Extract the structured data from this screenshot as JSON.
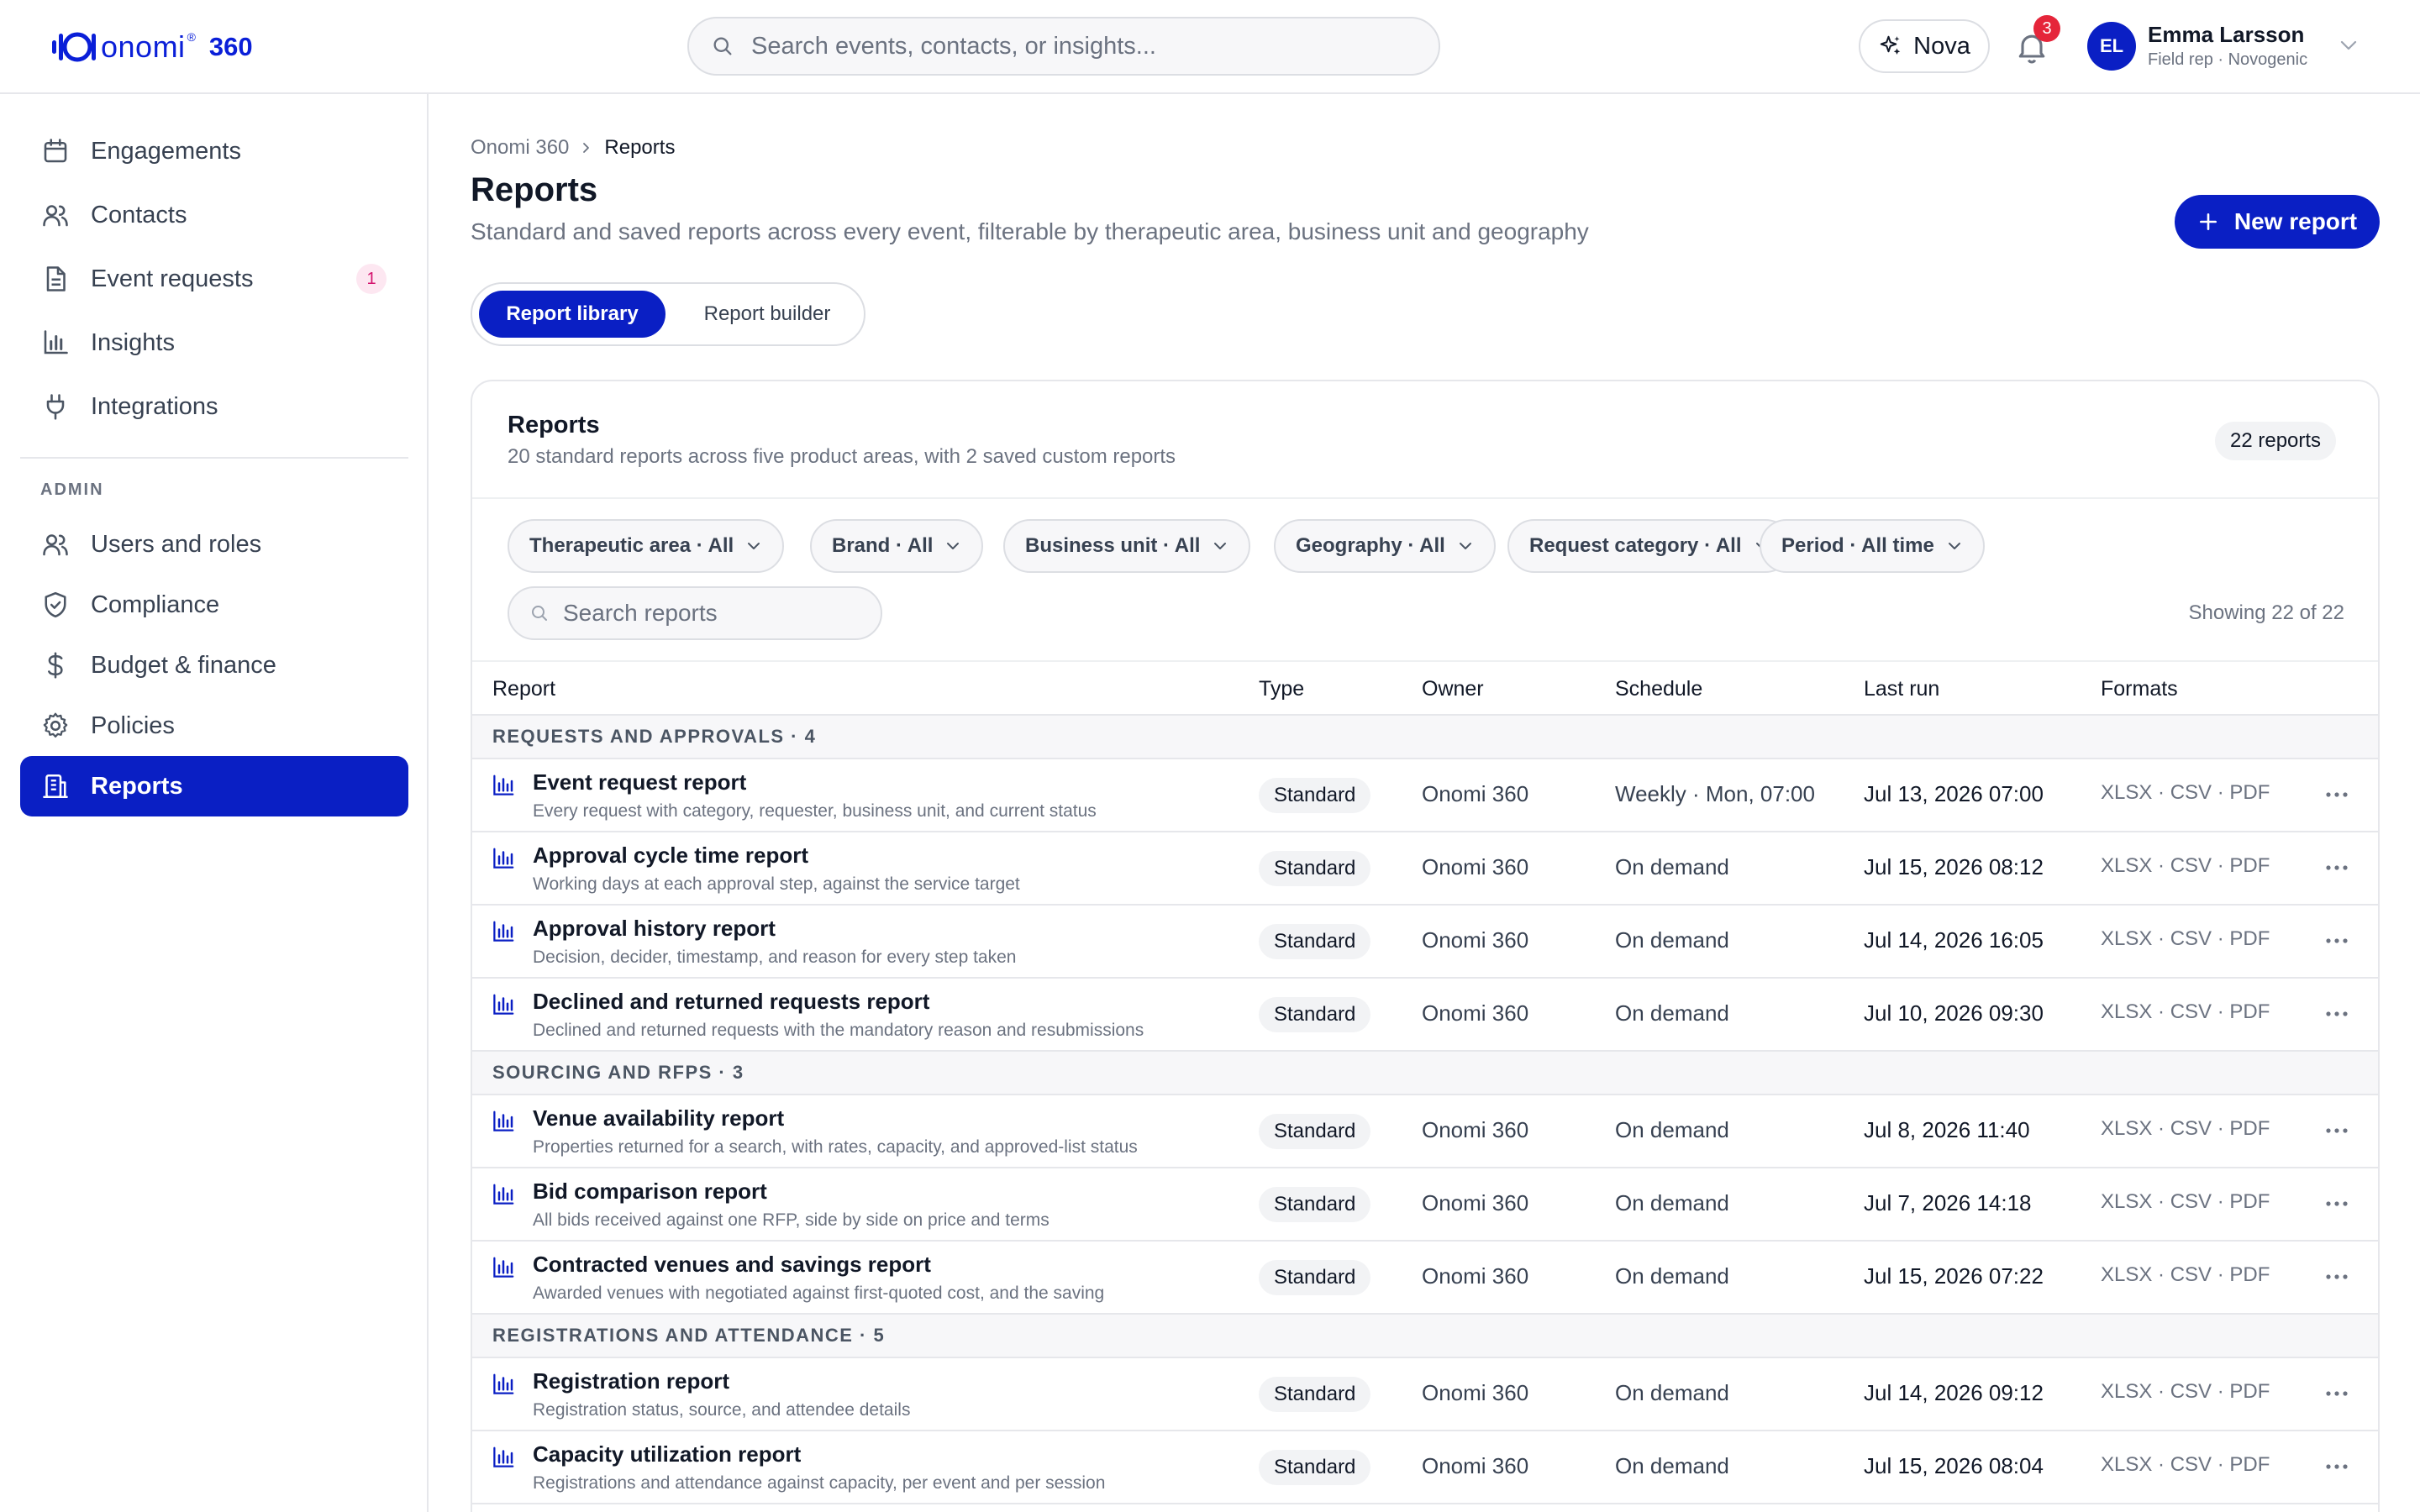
{
  "header": {
    "logo_text": "onomi",
    "logo_mark": "®",
    "logo_suffix": "360",
    "search_placeholder": "Search events, contacts, or insights...",
    "nova_label": "Nova",
    "notifications_count": "3",
    "user": {
      "initials": "EL",
      "name": "Emma Larsson",
      "role": "Field rep · Novogenic"
    }
  },
  "sidebar": {
    "items": [
      {
        "label": "Engagements",
        "icon": "calendar-icon"
      },
      {
        "label": "Contacts",
        "icon": "users-icon"
      },
      {
        "label": "Event requests",
        "icon": "document-icon",
        "badge": "1"
      },
      {
        "label": "Insights",
        "icon": "bar-chart-icon"
      },
      {
        "label": "Integrations",
        "icon": "plug-icon"
      }
    ],
    "admin_label": "ADMIN",
    "admin_items": [
      {
        "label": "Users and roles",
        "icon": "users-icon"
      },
      {
        "label": "Compliance",
        "icon": "shield-icon"
      },
      {
        "label": "Budget & finance",
        "icon": "dollar-icon"
      },
      {
        "label": "Policies",
        "icon": "gear-icon"
      },
      {
        "label": "Reports",
        "icon": "building-icon",
        "active": true
      }
    ]
  },
  "page": {
    "breadcrumb": [
      "Onomi 360",
      "Reports"
    ],
    "title": "Reports",
    "subtitle": "Standard and saved reports across every event, filterable by therapeutic area, business unit and geography",
    "new_report_label": "New report",
    "tabs": [
      {
        "label": "Report library",
        "active": true
      },
      {
        "label": "Report builder",
        "active": false
      }
    ]
  },
  "card": {
    "title": "Reports",
    "subtitle": "20 standard reports across five product areas, with 2 saved custom reports",
    "count": "22 reports",
    "filters": [
      "Therapeutic area · All",
      "Brand · All",
      "Business unit · All",
      "Geography · All",
      "Request category · All",
      "Period · All time"
    ],
    "search_placeholder": "Search reports",
    "showing": "Showing 22 of 22"
  },
  "table": {
    "columns": [
      "Report",
      "Type",
      "Owner",
      "Schedule",
      "Last run",
      "Formats"
    ],
    "groups": [
      {
        "label": "REQUESTS AND APPROVALS · 4",
        "rows": [
          {
            "name": "Event request report",
            "desc": "Every request with category, requester, business unit, and current status",
            "type": "Standard",
            "owner": "Onomi 360",
            "schedule": "Weekly · Mon, 07:00",
            "last_run": "Jul 13, 2026 07:00",
            "formats": "XLSX · CSV · PDF"
          },
          {
            "name": "Approval cycle time report",
            "desc": "Working days at each approval step, against the service target",
            "type": "Standard",
            "owner": "Onomi 360",
            "schedule": "On demand",
            "last_run": "Jul 15, 2026 08:12",
            "formats": "XLSX · CSV · PDF"
          },
          {
            "name": "Approval history report",
            "desc": "Decision, decider, timestamp, and reason for every step taken",
            "type": "Standard",
            "owner": "Onomi 360",
            "schedule": "On demand",
            "last_run": "Jul 14, 2026 16:05",
            "formats": "XLSX · CSV · PDF"
          },
          {
            "name": "Declined and returned requests report",
            "desc": "Declined and returned requests with the mandatory reason and resubmissions",
            "type": "Standard",
            "owner": "Onomi 360",
            "schedule": "On demand",
            "last_run": "Jul 10, 2026 09:30",
            "formats": "XLSX · CSV · PDF"
          }
        ]
      },
      {
        "label": "SOURCING AND RFPS · 3",
        "rows": [
          {
            "name": "Venue availability report",
            "desc": "Properties returned for a search, with rates, capacity, and approved-list status",
            "type": "Standard",
            "owner": "Onomi 360",
            "schedule": "On demand",
            "last_run": "Jul 8, 2026 11:40",
            "formats": "XLSX · CSV · PDF"
          },
          {
            "name": "Bid comparison report",
            "desc": "All bids received against one RFP, side by side on price and terms",
            "type": "Standard",
            "owner": "Onomi 360",
            "schedule": "On demand",
            "last_run": "Jul 7, 2026 14:18",
            "formats": "XLSX · CSV · PDF"
          },
          {
            "name": "Contracted venues and savings report",
            "desc": "Awarded venues with negotiated against first-quoted cost, and the saving",
            "type": "Standard",
            "owner": "Onomi 360",
            "schedule": "On demand",
            "last_run": "Jul 15, 2026 07:22",
            "formats": "XLSX · CSV · PDF"
          }
        ]
      },
      {
        "label": "REGISTRATIONS AND ATTENDANCE · 5",
        "rows": [
          {
            "name": "Registration report",
            "desc": "Registration status, source, and attendee details",
            "type": "Standard",
            "owner": "Onomi 360",
            "schedule": "On demand",
            "last_run": "Jul 14, 2026 09:12",
            "formats": "XLSX · CSV · PDF"
          },
          {
            "name": "Capacity utilization report",
            "desc": "Registrations and attendance against capacity, per event and per session",
            "type": "Standard",
            "owner": "Onomi 360",
            "schedule": "On demand",
            "last_run": "Jul 15, 2026 08:04",
            "formats": "XLSX · CSV · PDF"
          }
        ]
      }
    ]
  },
  "colors": {
    "accent": "#0a1fc4",
    "notification": "#e5253a",
    "badge_bg": "#fde7f1",
    "badge_text": "#d4146e"
  }
}
